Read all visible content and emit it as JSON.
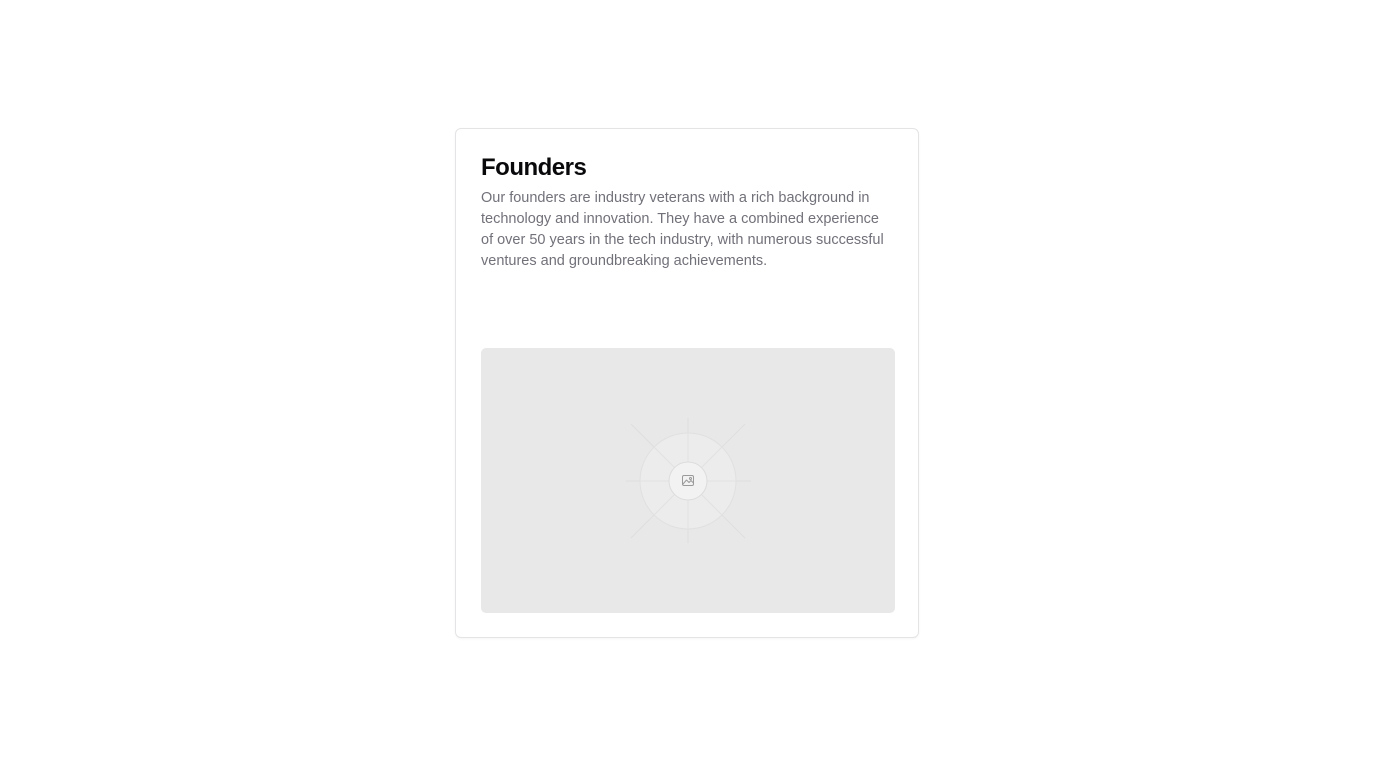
{
  "card": {
    "title": "Founders",
    "description": "Our founders are industry veterans with a rich background in technology and innovation. They have a combined experience of over 50 years in the tech industry, with numerous successful ventures and groundbreaking achievements."
  },
  "image": {
    "icon": "image-icon",
    "background": "#e8e8e8"
  },
  "colors": {
    "title": "#09090b",
    "description": "#71717a",
    "border": "#e4e4e7"
  }
}
